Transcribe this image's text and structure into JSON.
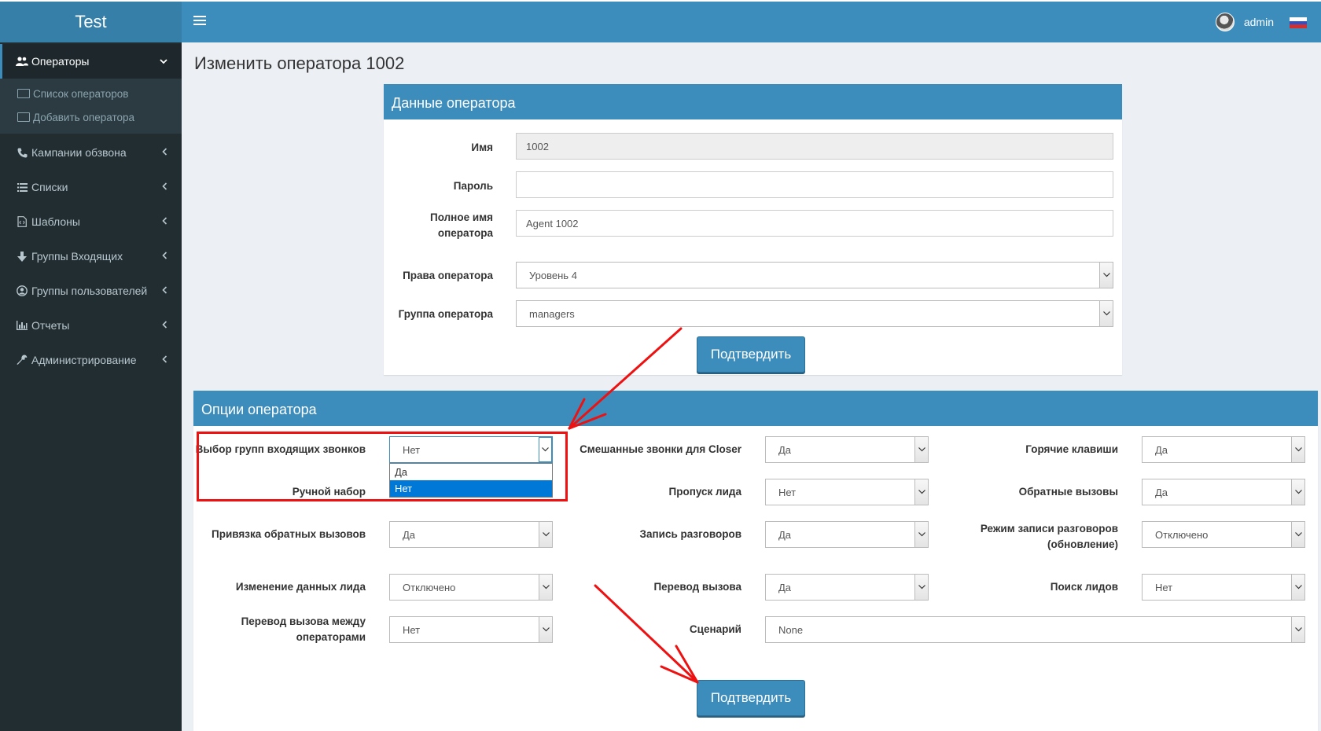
{
  "app": {
    "title": "Test"
  },
  "header": {
    "user": "admin",
    "flag_colors": [
      "#ffffff",
      "#3050c8",
      "#d03030"
    ]
  },
  "sidebar": {
    "active": {
      "label": "Операторы",
      "icon": "users-icon"
    },
    "subitems": [
      {
        "label": "Список операторов",
        "icon": "list-icon"
      },
      {
        "label": "Добавить оператора",
        "icon": "id-card-icon"
      }
    ],
    "items": [
      {
        "label": "Кампании обзвона",
        "icon": "phone-icon"
      },
      {
        "label": "Списки",
        "icon": "list-icon"
      },
      {
        "label": "Шаблоны",
        "icon": "file-code-icon"
      },
      {
        "label": "Группы Входящих",
        "icon": "arrow-down-icon"
      },
      {
        "label": "Группы пользователей",
        "icon": "user-circle-icon"
      },
      {
        "label": "Отчеты",
        "icon": "bar-chart-icon"
      },
      {
        "label": "Администрирование",
        "icon": "wrench-icon"
      }
    ]
  },
  "page": {
    "title": "Изменить оператора 1002"
  },
  "operator_data": {
    "header": "Данные оператора",
    "name_label": "Имя",
    "name_value": "1002",
    "password_label": "Пароль",
    "password_value": "",
    "fullname_label": "Полное имя оператора",
    "fullname_value": "Agent 1002",
    "rights_label": "Права оператора",
    "rights_value": "Уровень 4",
    "group_label": "Группа оператора",
    "group_value": "managers",
    "submit": "Подтвердить"
  },
  "operator_options": {
    "header": "Опции оператора",
    "fields": {
      "inbound_groups_label": "Выбор групп входящих звонков",
      "inbound_groups_value": "Нет",
      "manual_dial_label": "Ручной набор",
      "callbacks_bind_label": "Привязка обратных вызовов",
      "callbacks_bind_value": "Да",
      "lead_edit_label": "Изменение данных лида",
      "lead_edit_value": "Отключено",
      "agent_transfer_label": "Перевод вызова между операторами",
      "agent_transfer_value": "Нет",
      "closer_mixed_label": "Смешанные звонки для Closer",
      "closer_mixed_value": "Да",
      "lead_skip_label": "Пропуск лида",
      "lead_skip_value": "Нет",
      "recording_label": "Запись разговоров",
      "recording_value": "Да",
      "transfer_label": "Перевод вызова",
      "transfer_value": "Да",
      "script_label": "Сценарий",
      "script_value": "None",
      "hotkeys_label": "Горячие клавиши",
      "hotkeys_value": "Да",
      "callbacks_label": "Обратные вызовы",
      "callbacks_value": "Да",
      "rec_mode_label": "Режим записи разговоров (обновление)",
      "rec_mode_value": "Отключено",
      "lead_search_label": "Поиск лидов",
      "lead_search_value": "Нет"
    },
    "dropdown_options": [
      "Да",
      "Нет"
    ],
    "dropdown_selected": "Нет",
    "submit": "Подтвердить"
  },
  "annotation_color": "#ee1111"
}
